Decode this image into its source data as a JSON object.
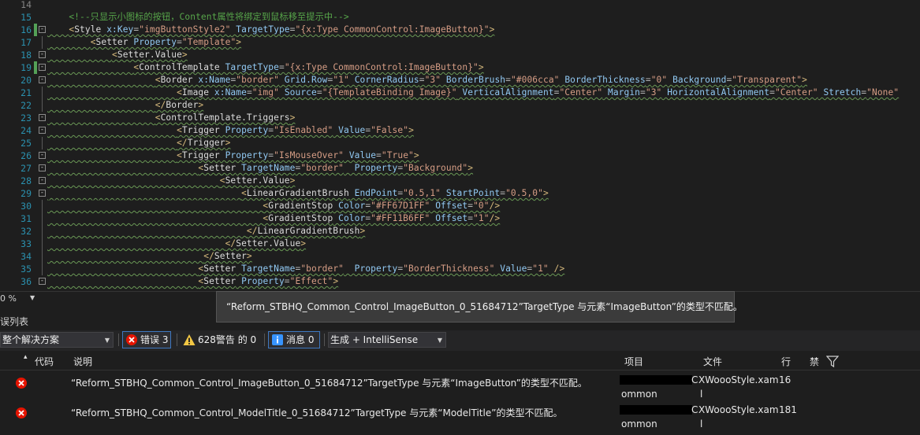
{
  "editor": {
    "lines": [
      {
        "n": "14",
        "dim": true,
        "fold": "",
        "changed": false,
        "tokens": []
      },
      {
        "n": "15",
        "dim": false,
        "fold": "",
        "changed": false,
        "tokens": [
          {
            "t": "    ",
            "c": "pl"
          },
          {
            "t": "<!--只显示小图标的按钮，Content属性将绑定到鼠标移至提示中-->",
            "c": "cm"
          }
        ]
      },
      {
        "n": "16",
        "dim": false,
        "fold": "-",
        "changed": true,
        "tokens": [
          {
            "t": "    ",
            "c": "pl"
          },
          {
            "t": "<",
            "c": "tg"
          },
          {
            "t": "Style",
            "c": "el"
          },
          {
            "t": " x:Key",
            "c": "at"
          },
          {
            "t": "=",
            "c": "pl"
          },
          {
            "t": "\"imgButtonStyle2\"",
            "c": "st"
          },
          {
            "t": " TargetType",
            "c": "at"
          },
          {
            "t": "=",
            "c": "pl"
          },
          {
            "t": "\"{x:Type CommonControl:ImageButton}\"",
            "c": "st"
          },
          {
            "t": ">",
            "c": "tg"
          }
        ]
      },
      {
        "n": "17",
        "dim": false,
        "fold": "",
        "changed": false,
        "tokens": [
          {
            "t": "        ",
            "c": "pl"
          },
          {
            "t": "<",
            "c": "tg"
          },
          {
            "t": "Setter",
            "c": "el"
          },
          {
            "t": " Property",
            "c": "at"
          },
          {
            "t": "=",
            "c": "pl"
          },
          {
            "t": "\"Template\"",
            "c": "st"
          },
          {
            "t": ">",
            "c": "tg"
          }
        ]
      },
      {
        "n": "18",
        "dim": false,
        "fold": "-",
        "changed": false,
        "tokens": [
          {
            "t": "            ",
            "c": "pl"
          },
          {
            "t": "<",
            "c": "tg"
          },
          {
            "t": "Setter.Value",
            "c": "el"
          },
          {
            "t": ">",
            "c": "tg"
          }
        ]
      },
      {
        "n": "19",
        "dim": false,
        "fold": "-",
        "changed": true,
        "tokens": [
          {
            "t": "                ",
            "c": "pl"
          },
          {
            "t": "<",
            "c": "tg"
          },
          {
            "t": "ControlTemplate",
            "c": "el"
          },
          {
            "t": " TargetType",
            "c": "at"
          },
          {
            "t": "=",
            "c": "pl"
          },
          {
            "t": "\"{x:Type CommonControl:ImageButton}\"",
            "c": "st"
          },
          {
            "t": ">",
            "c": "tg"
          }
        ]
      },
      {
        "n": "20",
        "dim": false,
        "fold": "-",
        "changed": false,
        "tokens": [
          {
            "t": "                    ",
            "c": "pl"
          },
          {
            "t": "<",
            "c": "tg"
          },
          {
            "t": "Border",
            "c": "el"
          },
          {
            "t": " x:Name",
            "c": "at"
          },
          {
            "t": "=",
            "c": "pl"
          },
          {
            "t": "\"border\"",
            "c": "st"
          },
          {
            "t": " Grid.Row",
            "c": "at"
          },
          {
            "t": "=",
            "c": "pl"
          },
          {
            "t": "\"1\"",
            "c": "st"
          },
          {
            "t": " CornerRadius",
            "c": "at"
          },
          {
            "t": "=",
            "c": "pl"
          },
          {
            "t": "\"3\"",
            "c": "st"
          },
          {
            "t": " BorderBrush",
            "c": "at"
          },
          {
            "t": "=",
            "c": "pl"
          },
          {
            "t": "\"#006cca\"",
            "c": "st"
          },
          {
            "t": " BorderThickness",
            "c": "at"
          },
          {
            "t": "=",
            "c": "pl"
          },
          {
            "t": "\"0\"",
            "c": "st"
          },
          {
            "t": " Background",
            "c": "at"
          },
          {
            "t": "=",
            "c": "pl"
          },
          {
            "t": "\"Transparent\"",
            "c": "st"
          },
          {
            "t": ">",
            "c": "tg"
          }
        ]
      },
      {
        "n": "21",
        "dim": false,
        "fold": "",
        "changed": false,
        "tokens": [
          {
            "t": "                        ",
            "c": "pl"
          },
          {
            "t": "<",
            "c": "tg"
          },
          {
            "t": "Image",
            "c": "el"
          },
          {
            "t": " x:Name",
            "c": "at"
          },
          {
            "t": "=",
            "c": "pl"
          },
          {
            "t": "\"img\"",
            "c": "st"
          },
          {
            "t": " Source",
            "c": "at"
          },
          {
            "t": "=",
            "c": "pl"
          },
          {
            "t": "\"{TemplateBinding Image}\"",
            "c": "st"
          },
          {
            "t": " VerticalAlignment",
            "c": "at"
          },
          {
            "t": "=",
            "c": "pl"
          },
          {
            "t": "\"Center\"",
            "c": "st"
          },
          {
            "t": " Margin",
            "c": "at"
          },
          {
            "t": "=",
            "c": "pl"
          },
          {
            "t": "\"3\"",
            "c": "st"
          },
          {
            "t": " HorizontalAlignment",
            "c": "at"
          },
          {
            "t": "=",
            "c": "pl"
          },
          {
            "t": "\"Center\"",
            "c": "st"
          },
          {
            "t": " Stretch",
            "c": "at"
          },
          {
            "t": "=",
            "c": "pl"
          },
          {
            "t": "\"None\"",
            "c": "st"
          }
        ]
      },
      {
        "n": "22",
        "dim": false,
        "fold": "",
        "changed": false,
        "tokens": [
          {
            "t": "                    ",
            "c": "pl"
          },
          {
            "t": "</",
            "c": "tg"
          },
          {
            "t": "Border",
            "c": "el"
          },
          {
            "t": ">",
            "c": "tg"
          }
        ]
      },
      {
        "n": "23",
        "dim": false,
        "fold": "-",
        "changed": false,
        "tokens": [
          {
            "t": "                    ",
            "c": "pl"
          },
          {
            "t": "<",
            "c": "tg"
          },
          {
            "t": "ControlTemplate.Triggers",
            "c": "el"
          },
          {
            "t": ">",
            "c": "tg"
          }
        ]
      },
      {
        "n": "24",
        "dim": false,
        "fold": "-",
        "changed": false,
        "tokens": [
          {
            "t": "                        ",
            "c": "pl"
          },
          {
            "t": "<",
            "c": "tg"
          },
          {
            "t": "Trigger",
            "c": "el"
          },
          {
            "t": " Property",
            "c": "at"
          },
          {
            "t": "=",
            "c": "pl"
          },
          {
            "t": "\"IsEnabled\"",
            "c": "st"
          },
          {
            "t": " Value",
            "c": "at"
          },
          {
            "t": "=",
            "c": "pl"
          },
          {
            "t": "\"False\"",
            "c": "st"
          },
          {
            "t": ">",
            "c": "tg"
          }
        ]
      },
      {
        "n": "25",
        "dim": false,
        "fold": "",
        "changed": false,
        "tokens": [
          {
            "t": "                        ",
            "c": "pl"
          },
          {
            "t": "</",
            "c": "tg"
          },
          {
            "t": "Trigger",
            "c": "el"
          },
          {
            "t": ">",
            "c": "tg"
          }
        ]
      },
      {
        "n": "26",
        "dim": false,
        "fold": "-",
        "changed": false,
        "tokens": [
          {
            "t": "                        ",
            "c": "pl"
          },
          {
            "t": "<",
            "c": "tg"
          },
          {
            "t": "Trigger",
            "c": "el"
          },
          {
            "t": " Property",
            "c": "at"
          },
          {
            "t": "=",
            "c": "pl"
          },
          {
            "t": "\"IsMouseOver\"",
            "c": "st"
          },
          {
            "t": " Value",
            "c": "at"
          },
          {
            "t": "=",
            "c": "pl"
          },
          {
            "t": "\"True\"",
            "c": "st"
          },
          {
            "t": ">",
            "c": "tg"
          }
        ]
      },
      {
        "n": "27",
        "dim": false,
        "fold": "-",
        "changed": false,
        "tokens": [
          {
            "t": "                            ",
            "c": "pl"
          },
          {
            "t": "<",
            "c": "tg"
          },
          {
            "t": "Setter",
            "c": "el"
          },
          {
            "t": " TargetName",
            "c": "at"
          },
          {
            "t": "=",
            "c": "pl"
          },
          {
            "t": "\"border\"",
            "c": "st"
          },
          {
            "t": "  Property",
            "c": "at"
          },
          {
            "t": "=",
            "c": "pl"
          },
          {
            "t": "\"Background\"",
            "c": "st"
          },
          {
            "t": ">",
            "c": "tg"
          }
        ]
      },
      {
        "n": "28",
        "dim": false,
        "fold": "-",
        "changed": false,
        "tokens": [
          {
            "t": "                                ",
            "c": "pl"
          },
          {
            "t": "<",
            "c": "tg"
          },
          {
            "t": "Setter.Value",
            "c": "el"
          },
          {
            "t": ">",
            "c": "tg"
          }
        ]
      },
      {
        "n": "29",
        "dim": false,
        "fold": "-",
        "changed": false,
        "tokens": [
          {
            "t": "                                    ",
            "c": "pl"
          },
          {
            "t": "<",
            "c": "tg"
          },
          {
            "t": "LinearGradientBrush",
            "c": "el"
          },
          {
            "t": " EndPoint",
            "c": "at"
          },
          {
            "t": "=",
            "c": "pl"
          },
          {
            "t": "\"0.5,1\"",
            "c": "st"
          },
          {
            "t": " StartPoint",
            "c": "at"
          },
          {
            "t": "=",
            "c": "pl"
          },
          {
            "t": "\"0.5,0\"",
            "c": "st"
          },
          {
            "t": ">",
            "c": "tg"
          }
        ]
      },
      {
        "n": "30",
        "dim": false,
        "fold": "",
        "changed": false,
        "tokens": [
          {
            "t": "                                        ",
            "c": "pl"
          },
          {
            "t": "<",
            "c": "tg"
          },
          {
            "t": "GradientStop",
            "c": "el"
          },
          {
            "t": " Color",
            "c": "at"
          },
          {
            "t": "=",
            "c": "pl"
          },
          {
            "t": "\"#FF67D1FF\"",
            "c": "st"
          },
          {
            "t": " Offset",
            "c": "at"
          },
          {
            "t": "=",
            "c": "pl"
          },
          {
            "t": "\"0\"",
            "c": "st"
          },
          {
            "t": "/>",
            "c": "tg"
          }
        ]
      },
      {
        "n": "31",
        "dim": false,
        "fold": "",
        "changed": false,
        "tokens": [
          {
            "t": "                                        ",
            "c": "pl"
          },
          {
            "t": "<",
            "c": "tg"
          },
          {
            "t": "GradientStop",
            "c": "el"
          },
          {
            "t": " Color",
            "c": "at"
          },
          {
            "t": "=",
            "c": "pl"
          },
          {
            "t": "\"#FF11B6FF\"",
            "c": "st"
          },
          {
            "t": " Offset",
            "c": "at"
          },
          {
            "t": "=",
            "c": "pl"
          },
          {
            "t": "\"1\"",
            "c": "st"
          },
          {
            "t": "/>",
            "c": "tg"
          }
        ]
      },
      {
        "n": "32",
        "dim": false,
        "fold": "",
        "changed": false,
        "tokens": [
          {
            "t": "                                     ",
            "c": "pl"
          },
          {
            "t": "</",
            "c": "tg"
          },
          {
            "t": "LinearGradientBrush",
            "c": "el"
          },
          {
            "t": ">",
            "c": "tg"
          }
        ]
      },
      {
        "n": "33",
        "dim": false,
        "fold": "",
        "changed": false,
        "tokens": [
          {
            "t": "                                 ",
            "c": "pl"
          },
          {
            "t": "</",
            "c": "tg"
          },
          {
            "t": "Setter.Value",
            "c": "el"
          },
          {
            "t": ">",
            "c": "tg"
          }
        ]
      },
      {
        "n": "34",
        "dim": false,
        "fold": "",
        "changed": false,
        "tokens": [
          {
            "t": "                             ",
            "c": "pl"
          },
          {
            "t": "</",
            "c": "tg"
          },
          {
            "t": "Setter",
            "c": "el"
          },
          {
            "t": ">",
            "c": "tg"
          }
        ]
      },
      {
        "n": "35",
        "dim": false,
        "fold": "",
        "changed": false,
        "tokens": [
          {
            "t": "                            ",
            "c": "pl"
          },
          {
            "t": "<",
            "c": "tg"
          },
          {
            "t": "Setter",
            "c": "el"
          },
          {
            "t": " TargetName",
            "c": "at"
          },
          {
            "t": "=",
            "c": "pl"
          },
          {
            "t": "\"border\"",
            "c": "st"
          },
          {
            "t": "  Property",
            "c": "at"
          },
          {
            "t": "=",
            "c": "pl"
          },
          {
            "t": "\"BorderThickness\"",
            "c": "st"
          },
          {
            "t": " Value",
            "c": "at"
          },
          {
            "t": "=",
            "c": "pl"
          },
          {
            "t": "\"1\"",
            "c": "st"
          },
          {
            "t": " />",
            "c": "tg"
          }
        ]
      },
      {
        "n": "36",
        "dim": false,
        "fold": "-",
        "changed": false,
        "tokens": [
          {
            "t": "                            ",
            "c": "pl"
          },
          {
            "t": "<",
            "c": "tg"
          },
          {
            "t": "Setter",
            "c": "el"
          },
          {
            "t": " Property",
            "c": "at"
          },
          {
            "t": "=",
            "c": "pl"
          },
          {
            "t": "\"Effect\"",
            "c": "st"
          },
          {
            "t": ">",
            "c": "tg"
          }
        ]
      }
    ]
  },
  "zoom": {
    "value": "0 %"
  },
  "tooltip": {
    "text": "“Reform_STBHQ_Common_Control_ImageButton_0_51684712”TargetType 与元素“ImageButton”的类型不匹配。"
  },
  "panel": {
    "title": "误列表"
  },
  "toolbar": {
    "scope": "整个解决方案",
    "errors_label": "错误 3",
    "warnings_label": "628警告 的 0",
    "messages_label": "消息 0",
    "build_filter": "生成 + IntelliSense"
  },
  "grid": {
    "headers": {
      "code": "代码",
      "desc": "说明",
      "project": "项目",
      "file": "文件",
      "line": "行",
      "suppress": "禁"
    },
    "rows": [
      {
        "desc": "“Reform_STBHQ_Common_Control_ImageButton_0_51684712”TargetType 与元素“ImageButton”的类型不匹配。",
        "project_tail": "ommon",
        "file_prefix": "C",
        "file": "XWoooStyle.xam",
        "file_tail": "l",
        "line": "16"
      },
      {
        "desc": "“Reform_STBHQ_Common_Control_ModelTitle_0_51684712”TargetType 与元素“ModelTitle”的类型不匹配。",
        "project_tail": "ommon",
        "file_prefix": "C",
        "file": "XWoooStyle.xam",
        "file_tail": "l",
        "line": "181"
      }
    ]
  },
  "colors": {
    "error": "#e51400",
    "warning": "#f2c744",
    "info": "#3794ff",
    "accent": "#3e78c1"
  }
}
